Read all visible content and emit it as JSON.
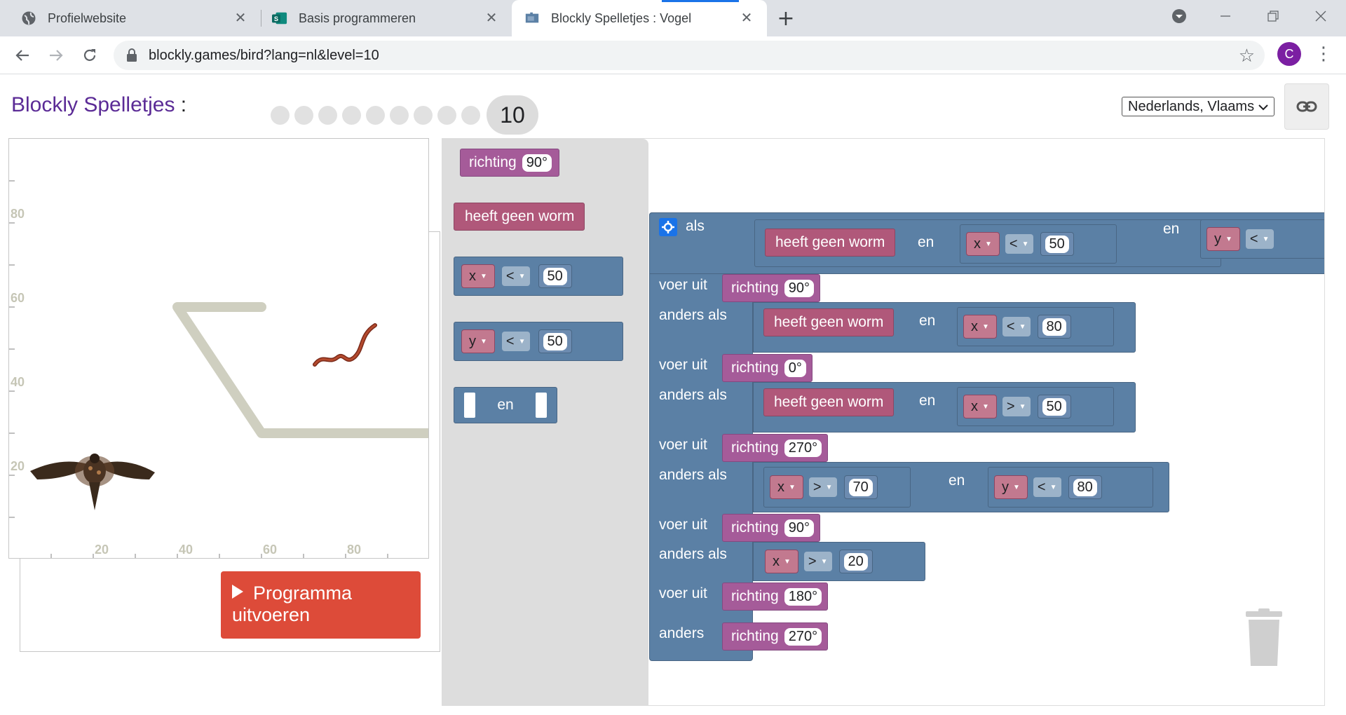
{
  "browser": {
    "tabs": [
      {
        "title": "Profielwebsite",
        "icon": "globe-icon"
      },
      {
        "title": "Basis programmeren",
        "icon": "sway-icon"
      },
      {
        "title": "Blockly Spelletjes : Vogel",
        "icon": "puzzle-icon"
      }
    ],
    "url": "blockly.games/bird?lang=nl&level=10",
    "profile_initial": "C"
  },
  "header": {
    "brand": "Blockly Spelletjes",
    "separator": " : ",
    "game": "Vogel",
    "current_level": "10",
    "language": "Nederlands, Vlaams"
  },
  "game": {
    "y_ticks": [
      "80",
      "60",
      "40",
      "20"
    ],
    "x_ticks": [
      "20",
      "40",
      "60",
      "80"
    ],
    "run_button_line1": "Programma",
    "run_button_line2": "uitvoeren"
  },
  "flyout": {
    "heading_label": "richting",
    "heading_value": "90°",
    "no_worm": "heeft geen worm",
    "cmp1": {
      "var": "x",
      "op": "<",
      "val": "50"
    },
    "cmp2": {
      "var": "y",
      "op": "<",
      "val": "50"
    },
    "and_label": "en"
  },
  "program": {
    "if_label": "als",
    "do_label": "voer uit",
    "elseif_label": "anders als",
    "else_label": "anders",
    "and_label": "en",
    "heading_label": "richting",
    "no_worm": "heeft geen worm",
    "c0": {
      "var_a": "x",
      "op_a": "<",
      "val_a": "50",
      "var_b": "y",
      "op_b": "<"
    },
    "h0": "90°",
    "c1": {
      "var": "x",
      "op": "<",
      "val": "80"
    },
    "h1": "0°",
    "c2": {
      "var": "x",
      "op": ">",
      "val": "50"
    },
    "h2": "270°",
    "c3": {
      "var_a": "x",
      "op_a": ">",
      "val_a": "70",
      "var_b": "y",
      "op_b": "<",
      "val_b": "80"
    },
    "h3": "90°",
    "c4": {
      "var": "x",
      "op": ">",
      "val": "20"
    },
    "h4": "180°",
    "h5": "270°"
  }
}
